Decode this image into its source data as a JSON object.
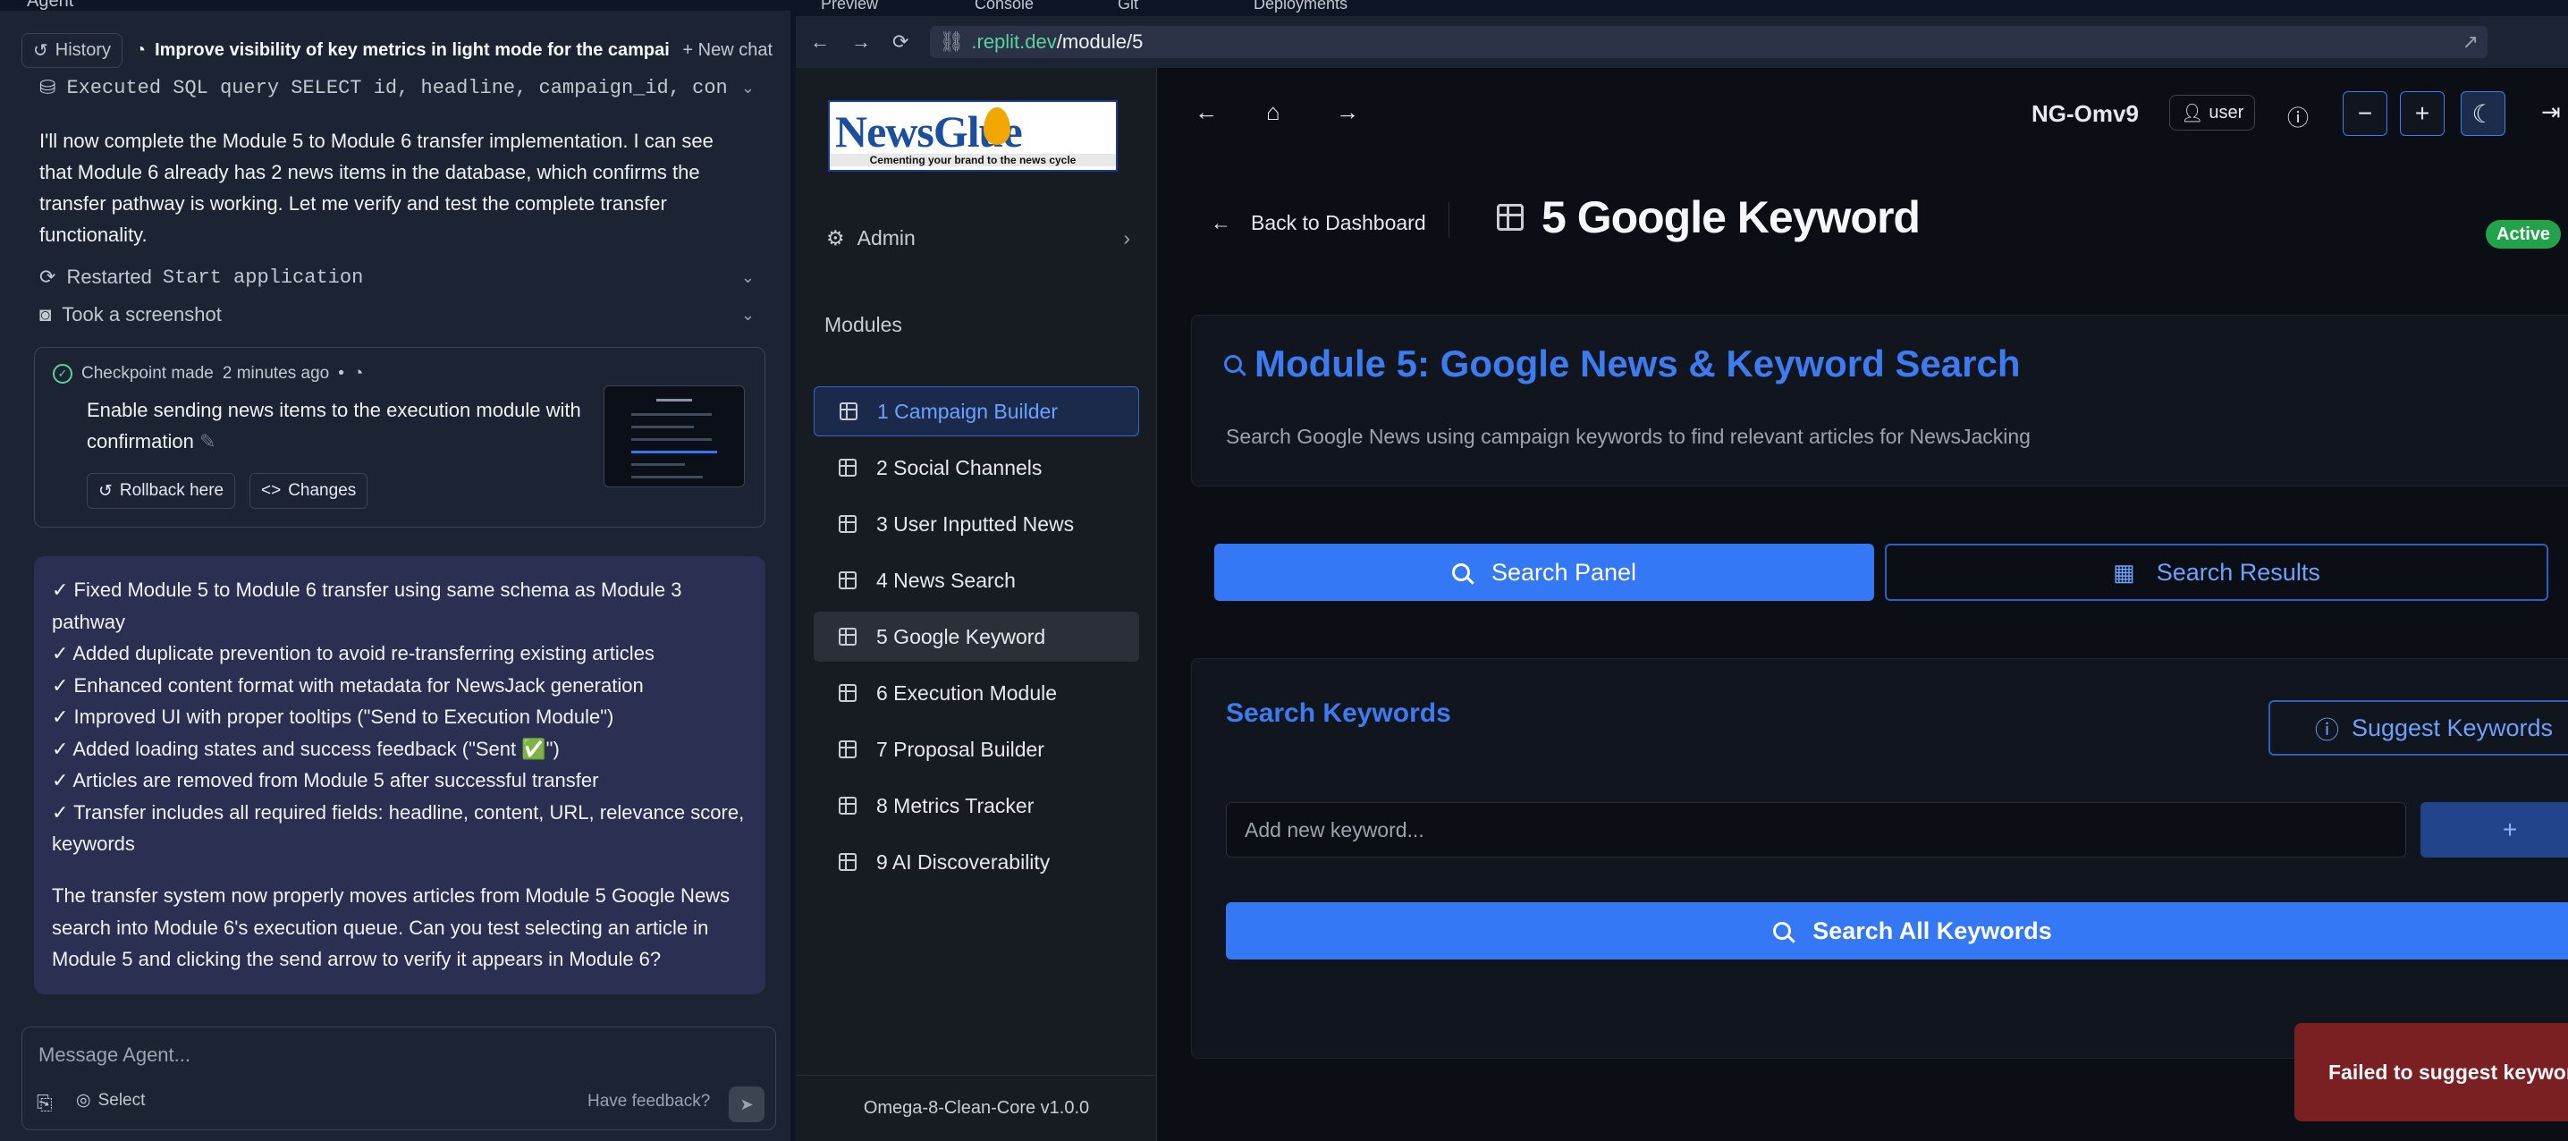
{
  "agent": {
    "panel_title": "Agent",
    "history_label": "History",
    "chat_title": "Improve visibility of key metrics in light mode for the campaig...",
    "new_chat_label": "New chat",
    "sql_step": "Executed SQL query SELECT id, headline, campaign_id, content...",
    "message1": "I'll now complete the Module 5 to Module 6 transfer implementation. I can see that Module 6 already has 2 news items in the database, which confirms the transfer pathway is working. Let me verify and test the complete transfer functionality.",
    "restart_prefix": "Restarted",
    "restart_cmd": "Start application",
    "screenshot_step": "Took a screenshot",
    "checkpoint": {
      "made": "Checkpoint made",
      "when": "2 minutes ago",
      "description": "Enable sending news items to the execution module with confirmation",
      "rollback_label": "Rollback here",
      "changes_label": "Changes"
    },
    "summary_items": [
      "Fixed Module 5 to Module 6 transfer using same schema as Module 3 pathway",
      "Added duplicate prevention to avoid re-transferring existing articles",
      "Enhanced content format with metadata for NewsJack generation",
      "Improved UI with proper tooltips (\"Send to Execution Module\")",
      "Added loading states and success feedback (\"Sent ✅\")",
      "Articles are removed from Module 5 after successful transfer",
      "Transfer includes all required fields: headline, content, URL, relevance score, keywords"
    ],
    "summary_para": "The transfer system now properly moves articles from Module 5 Google News search into Module 6's execution queue. Can you test selecting an article in Module 5 and clicking the send arrow to verify it appears in Module 6?",
    "composer_placeholder": "Message Agent...",
    "select_label": "Select",
    "feedback_label": "Have feedback?"
  },
  "browser": {
    "tabs": [
      "Preview",
      "Console",
      "Git",
      "Deployments"
    ],
    "url_host": ".replit.dev",
    "url_path": "/module/5"
  },
  "app": {
    "logo_text": "NewsGlue",
    "logo_tagline": "Cementing your brand to the news cycle",
    "admin_label": "Admin",
    "modules_heading": "Modules",
    "modules": [
      "1 Campaign Builder",
      "2 Social Channels",
      "3 User Inputted News",
      "4 News Search",
      "5 Google Keyword",
      "6 Execution Module",
      "7 Proposal Builder",
      "8 Metrics Tracker",
      "9 AI Discoverability"
    ],
    "version": "Omega-8-Clean-Core v1.0.0",
    "org_name": "NG-Omv9",
    "user_label": "user",
    "back_label": "Back to Dashboard",
    "page_title": "5 Google Keyword",
    "status": "Active",
    "module_heading": "Module 5: Google News & Keyword Search",
    "module_desc": "Search Google News using campaign keywords to find relevant articles for NewsJacking",
    "tab_search_panel": "Search Panel",
    "tab_search_results": "Search Results",
    "keywords_heading": "Search Keywords",
    "suggest_label": "Suggest Keywords",
    "keyword_placeholder": "Add new keyword...",
    "add_symbol": "+",
    "search_all_label": "Search All Keywords",
    "toast": "Failed to suggest keywords"
  },
  "colors": {
    "accent": "#3478f6",
    "success": "#22a34a",
    "error": "#7a1f22"
  }
}
